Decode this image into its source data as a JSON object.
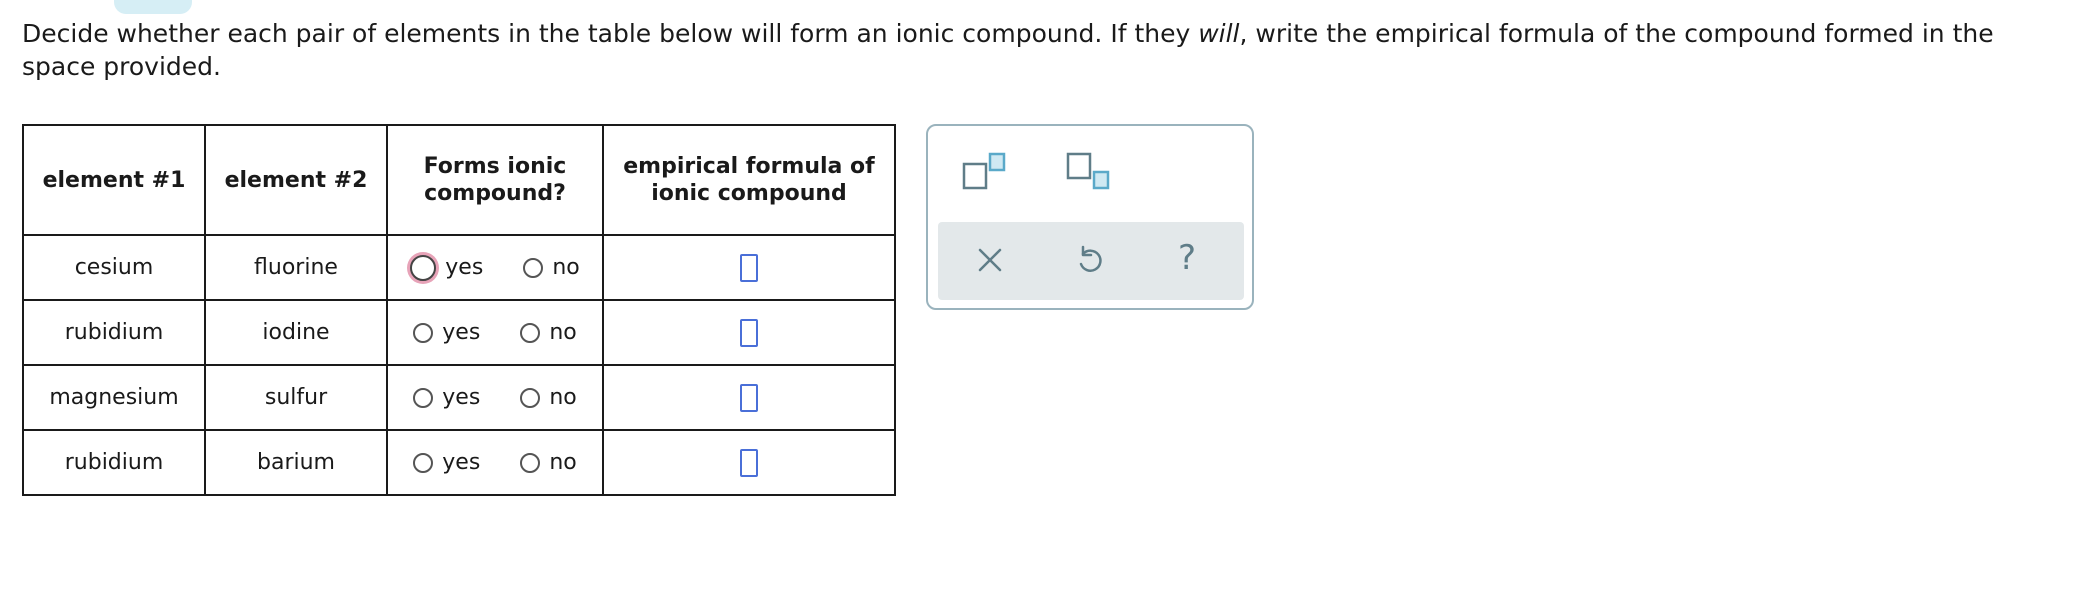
{
  "instructions": {
    "part1": "Decide whether each pair of elements in the table below will form an ionic compound. If they ",
    "emphasis": "will",
    "part2": ", write the empirical formula of the compound formed in the space provided."
  },
  "table": {
    "headers": {
      "element1": "element #1",
      "element2": "element #2",
      "forms_ionic_line1": "Forms ionic",
      "forms_ionic_line2": "compound?",
      "formula_line1": "empirical formula of",
      "formula_line2": "ionic compound"
    },
    "option_yes": "yes",
    "option_no": "no",
    "rows": [
      {
        "element1": "cesium",
        "element2": "fluorine",
        "selected": null,
        "focused": "yes"
      },
      {
        "element1": "rubidium",
        "element2": "iodine",
        "selected": null
      },
      {
        "element1": "magnesium",
        "element2": "sulfur",
        "selected": null
      },
      {
        "element1": "rubidium",
        "element2": "barium",
        "selected": null
      }
    ]
  },
  "tool_panel": {
    "icons": [
      "superscript-icon",
      "subscript-icon",
      "clear-icon",
      "undo-icon",
      "help-icon"
    ],
    "help_glyph": "?",
    "colors": {
      "accent": "#5aa9c9",
      "icon": "#5f7d88",
      "answer_box": "#4a6fd8",
      "focus_ring": "#e7a3b8"
    }
  }
}
